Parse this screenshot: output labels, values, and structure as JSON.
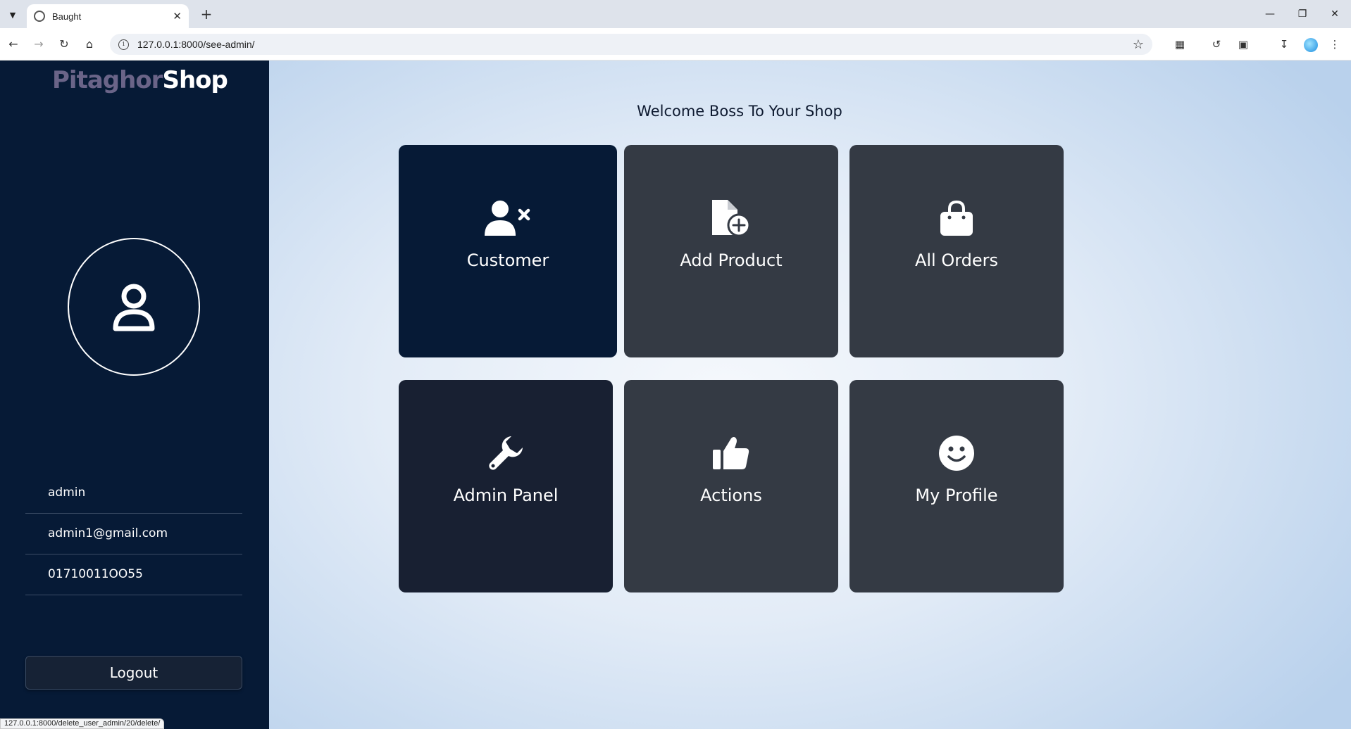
{
  "browser": {
    "tab_title": "Baught",
    "url": "127.0.0.1:8000/see-admin/",
    "status_url": "127.0.0.1:8000/delete_user_admin/20/delete/"
  },
  "sidebar": {
    "logo_part1": "Pitaghor",
    "logo_part2": "Shop",
    "username": "admin",
    "email": "admin1@gmail.com",
    "phone": "01710011OO55",
    "logout_label": "Logout"
  },
  "main": {
    "welcome": "Welcome Boss To Your Shop",
    "cards": [
      {
        "label": "Customer",
        "icon": "user-remove-icon",
        "color": "#061a36"
      },
      {
        "label": "Add Product",
        "icon": "file-add-icon",
        "color": "#343a44"
      },
      {
        "label": "All Orders",
        "icon": "shopping-bag-icon",
        "color": "#343a44"
      },
      {
        "label": "Admin Panel",
        "icon": "wrench-icon",
        "color": "#182032"
      },
      {
        "label": "Actions",
        "icon": "thumbs-up-icon",
        "color": "#343a44"
      },
      {
        "label": "My Profile",
        "icon": "smile-icon",
        "color": "#343a44"
      }
    ]
  },
  "colors": {
    "sidebar_bg": "#061a36",
    "logo_accent": "#6a6488",
    "card_dark": "#343a44"
  }
}
